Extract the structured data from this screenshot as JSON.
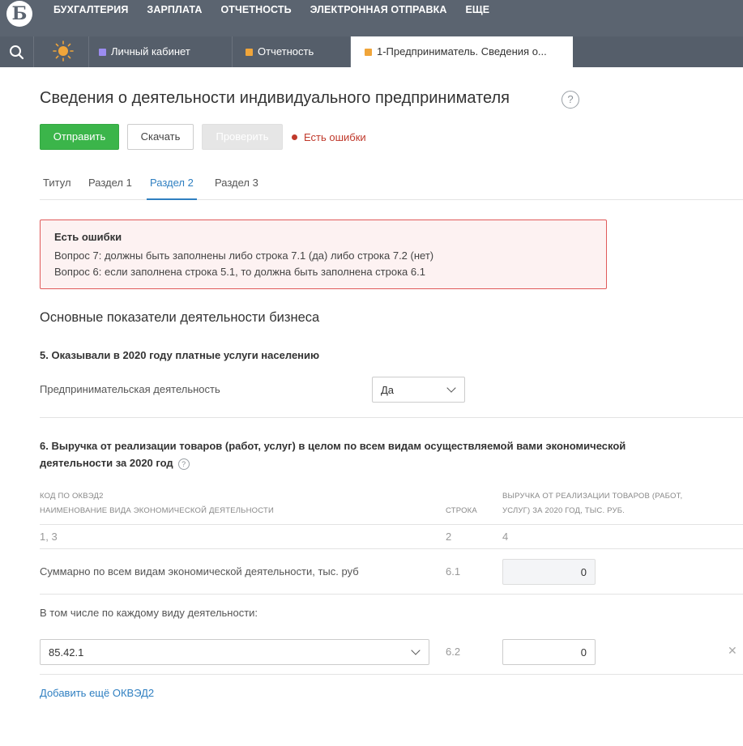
{
  "top_nav": {
    "logo": "Б",
    "items": [
      "БУХГАЛТЕРИЯ",
      "ЗАРПЛАТА",
      "ОТЧЕТНОСТЬ",
      "ЭЛЕКТРОННАЯ ОТПРАВКА",
      "ЕЩЕ"
    ]
  },
  "tabbar": {
    "search_icon": "search-icon",
    "theme_icon": "sun-icon",
    "tabs": [
      {
        "label": "Личный кабинет",
        "color": "#9b8cf0"
      },
      {
        "label": "Отчетность",
        "color": "#f0a53a"
      },
      {
        "label": "1-Предприниматель. Сведения о...",
        "color": "#f0a53a"
      }
    ]
  },
  "page": {
    "title": "Сведения о деятельности индивидуального предпринимателя",
    "help": "?"
  },
  "toolbar": {
    "send": "Отправить",
    "download": "Скачать",
    "check": "Проверить",
    "errors_status": "Есть ошибки"
  },
  "tabs": [
    "Титул",
    "Раздел 1",
    "Раздел 2",
    "Раздел 3"
  ],
  "active_tab": "Раздел 2",
  "error_box": {
    "title": "Есть ошибки",
    "lines": [
      "Вопрос 7: должны быть заполнены либо строка 7.1 (да) либо строка 7.2 (нет)",
      "Вопрос 6: если заполнена строка 5.1, то должна быть заполнена строка 6.1"
    ]
  },
  "section": {
    "title": "Основные показатели деятельности бизнеса",
    "q5": {
      "title": "5. Оказывали в 2020 году платные услуги населению",
      "field_label": "Предпринимательская деятельность",
      "value": "Да"
    },
    "q6": {
      "title": "6. Выручка от реализации товаров (работ, услуг) в целом по всем видам осуществляемой вами экономической деятельности за 2020 год",
      "table": {
        "col1_line1": "Код по ОКВЭД2",
        "col1_line2": "Наименование вида экономической деятельности",
        "col2": "Строка",
        "col3_line1": "Выручка от реализации товаров (работ,",
        "col3_line2": "услуг) за 2020 год, тыс. руб.",
        "num_row": [
          "1, 3",
          "2",
          "4"
        ],
        "total_label": "Суммарно по всем видам экономической деятельности, тыс. руб",
        "total_line": "6.1",
        "total_value": "0",
        "subheading": "В том числе по каждому виду деятельности:",
        "okved_code": "85.42.1",
        "okved_line": "6.2",
        "okved_value": "0"
      },
      "add_link": "Добавить ещё ОКВЭД2"
    }
  }
}
